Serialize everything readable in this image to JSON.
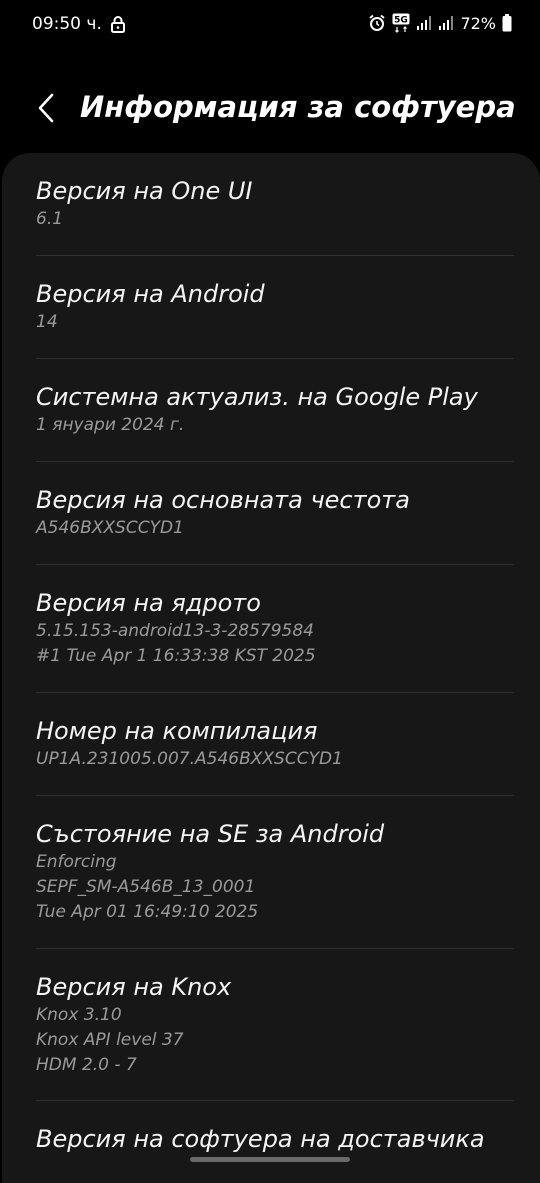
{
  "status_bar": {
    "time": "09:50 ч.",
    "battery": "72%",
    "network": "5G",
    "icons": [
      "lock-icon",
      "alarm-icon",
      "5g-icon",
      "signal-icon",
      "signal-icon",
      "battery-icon"
    ]
  },
  "header": {
    "back_icon": "chevron-left-icon",
    "title": "Информация за софтуера"
  },
  "items": [
    {
      "title": "Версия на One UI",
      "lines": [
        "6.1"
      ]
    },
    {
      "title": "Версия на Android",
      "lines": [
        "14"
      ]
    },
    {
      "title": "Системна актуализ. на Google Play",
      "lines": [
        "1 януари 2024 г."
      ]
    },
    {
      "title": "Версия на основната честота",
      "lines": [
        "A546BXXSCCYD1"
      ]
    },
    {
      "title": "Версия на ядрото",
      "lines": [
        "5.15.153-android13-3-28579584",
        "#1 Tue Apr 1 16:33:38 KST 2025"
      ]
    },
    {
      "title": "Номер на компилация",
      "lines": [
        "UP1A.231005.007.A546BXXSCCYD1"
      ]
    },
    {
      "title": "Състояние на SE за Android",
      "lines": [
        "Enforcing",
        "SEPF_SM-A546B_13_0001",
        "Tue Apr 01 16:49:10 2025"
      ]
    },
    {
      "title": "Версия на Knox",
      "lines": [
        "Knox 3.10",
        "Knox API level 37",
        "HDM 2.0 - 7"
      ]
    },
    {
      "title": "Версия на софтуера на доставчика",
      "lines": []
    }
  ],
  "colors": {
    "background": "#000000",
    "card": "#171717",
    "title_text": "#f4f4f4",
    "subtitle_text": "#9a9a9a",
    "divider": "#2e2e2e"
  }
}
